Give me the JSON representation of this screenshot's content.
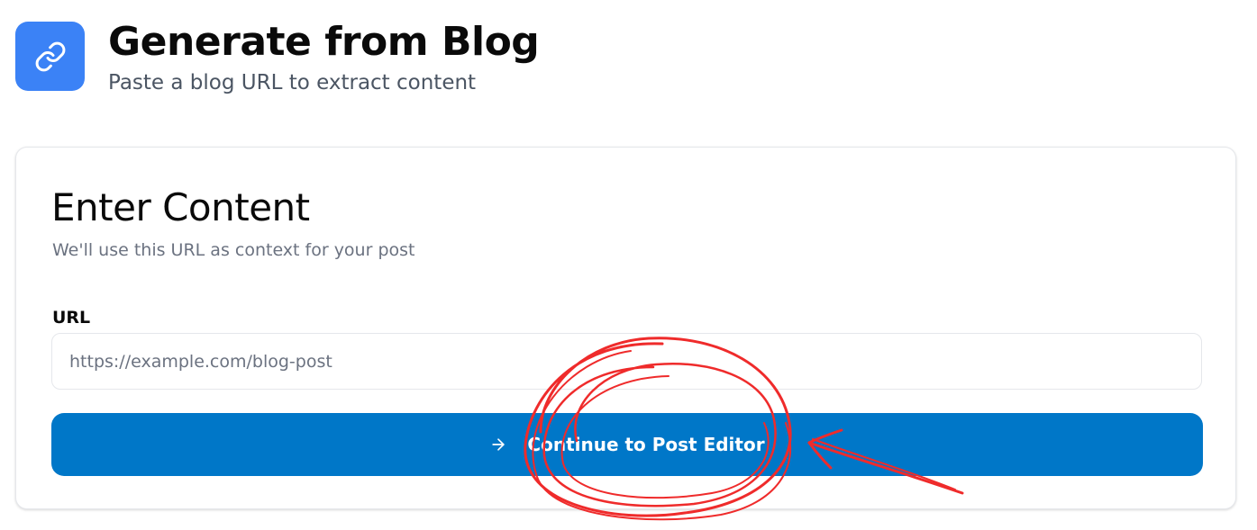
{
  "header": {
    "icon": "link-icon",
    "title": "Generate from Blog",
    "subtitle": "Paste a blog URL to extract content"
  },
  "card": {
    "title": "Enter Content",
    "description": "We'll use this URL as context for your post",
    "url_field": {
      "label": "URL",
      "value": "",
      "placeholder": "https://example.com/blog-post"
    },
    "continue_button": {
      "icon": "arrow-right-icon",
      "label": "Continue to Post Editor"
    }
  },
  "annotation": {
    "type": "hand-drawn-circle-and-arrow",
    "color": "#ef2b2b"
  },
  "colors": {
    "accent_icon_bg": "#3b82f6",
    "primary_button": "#0077c8",
    "muted_text": "#6b7280",
    "border": "#e5e7eb"
  }
}
